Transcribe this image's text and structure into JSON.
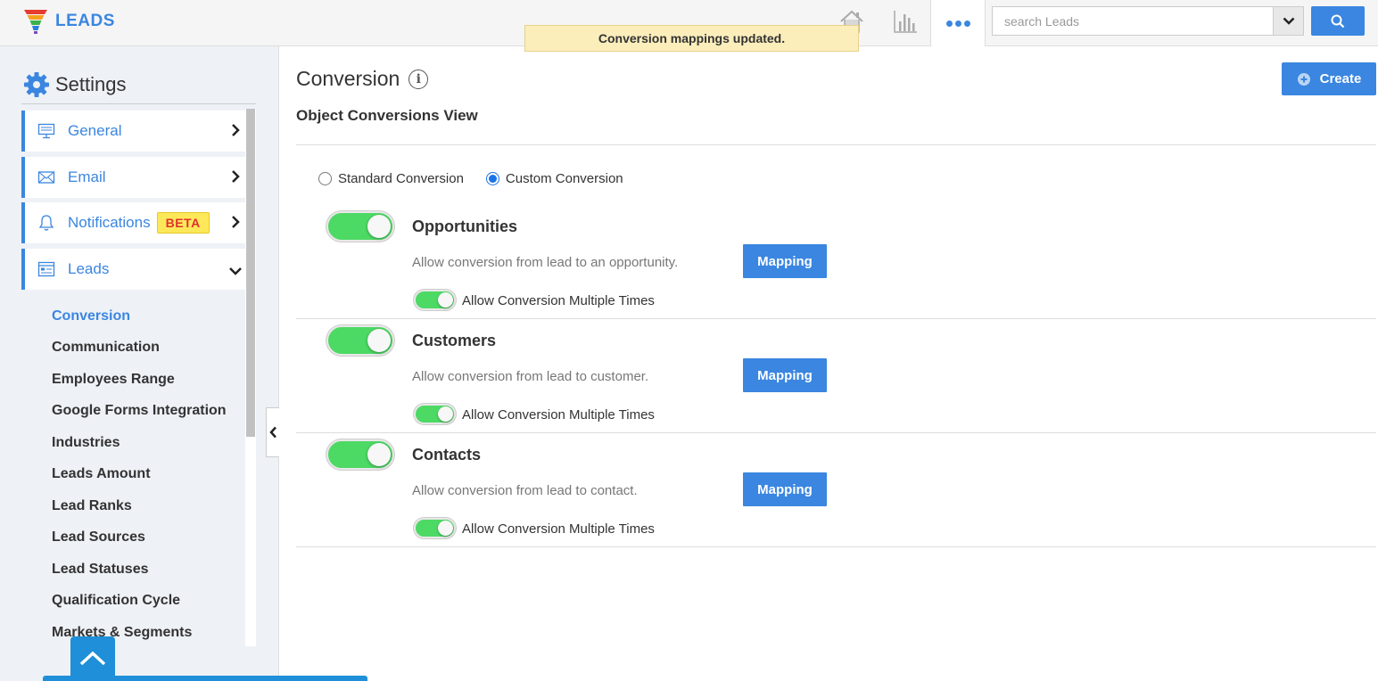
{
  "app": {
    "name": "LEADS"
  },
  "colors": {
    "accent": "#3a86e0",
    "toggle_on": "#4cd964",
    "toast_bg": "#fbeebb",
    "beta_bg": "#fde85a",
    "beta_text": "#e0322d"
  },
  "topbar": {
    "icons": [
      "home-icon",
      "bar-chart-icon",
      "more-icon"
    ],
    "search": {
      "placeholder": "search Leads",
      "value": ""
    }
  },
  "toast": {
    "message": "Conversion mappings updated."
  },
  "sidebar": {
    "title": "Settings",
    "menu": [
      {
        "label": "General",
        "icon": "monitor-icon",
        "state": "collapsed"
      },
      {
        "label": "Email",
        "icon": "envelope-icon",
        "state": "collapsed"
      },
      {
        "label": "Notifications",
        "icon": "bell-icon",
        "badge": "BETA",
        "state": "collapsed"
      },
      {
        "label": "Leads",
        "icon": "leads-list-icon",
        "state": "expanded"
      }
    ],
    "submenu": [
      {
        "label": "Conversion",
        "active": true
      },
      {
        "label": "Communication"
      },
      {
        "label": "Employees Range"
      },
      {
        "label": "Google Forms Integration"
      },
      {
        "label": "Industries"
      },
      {
        "label": "Leads Amount"
      },
      {
        "label": "Lead Ranks"
      },
      {
        "label": "Lead Sources"
      },
      {
        "label": "Lead Statuses"
      },
      {
        "label": "Qualification Cycle"
      },
      {
        "label": "Markets & Segments"
      }
    ]
  },
  "main": {
    "title": "Conversion",
    "subtitle": "Object Conversions View",
    "create_label": "Create",
    "radios": [
      {
        "label": "Standard Conversion",
        "checked": false
      },
      {
        "label": "Custom Conversion",
        "checked": true
      }
    ],
    "objects": [
      {
        "title": "Opportunities",
        "description": "Allow conversion from lead to an opportunity.",
        "enabled": true,
        "mapping_label": "Mapping",
        "multi_label": "Allow Conversion Multiple Times",
        "multi_enabled": true
      },
      {
        "title": "Customers",
        "description": "Allow conversion from lead to customer.",
        "enabled": true,
        "mapping_label": "Mapping",
        "multi_label": "Allow Conversion Multiple Times",
        "multi_enabled": true
      },
      {
        "title": "Contacts",
        "description": "Allow conversion from lead to contact.",
        "enabled": true,
        "mapping_label": "Mapping",
        "multi_label": "Allow Conversion Multiple Times",
        "multi_enabled": true
      }
    ]
  }
}
